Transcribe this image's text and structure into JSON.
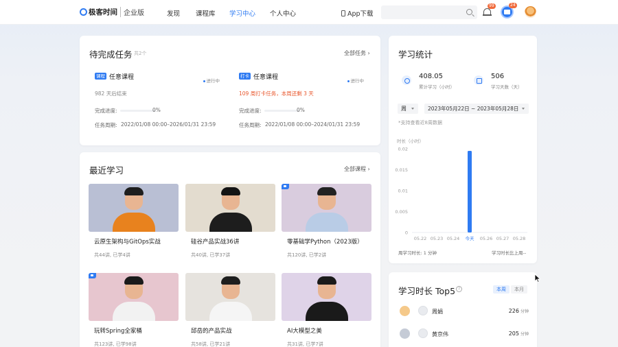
{
  "header": {
    "logo": "极客时间",
    "logo_edition": "企业版",
    "nav": [
      "发现",
      "课程库",
      "学习中心",
      "个人中心"
    ],
    "active_nav": "学习中心",
    "app_download": "App下载",
    "search_placeholder": "",
    "bell_badge": "99",
    "vip_badge": "24"
  },
  "tasks": {
    "title": "待完成任务",
    "count": "共2个",
    "all_label": "全部任务",
    "items": [
      {
        "tag": "课程",
        "name": "任意课程",
        "status": "进行中",
        "note": "982 天后结束",
        "progress_label": "完成进度:",
        "progress": "0%",
        "period_label": "任务周期:",
        "period": "2022/01/08 00:00–2026/01/31 23:59"
      },
      {
        "tag": "打卡",
        "name": "任意课程",
        "status": "进行中",
        "note": "109 周打卡任务，本周还剩 3 天",
        "progress_label": "完成进度:",
        "progress": "0%",
        "period_label": "任务周期:",
        "period": "2022/01/08 00:00–2024/01/31 23:59"
      }
    ]
  },
  "recent": {
    "title": "最近学习",
    "all_label": "全部课程",
    "courses": [
      {
        "title": "云原生架构与GitOps实战",
        "meta": "共44讲, 已学4讲",
        "bg": "#b9bfd4",
        "shirt": "#e8821e",
        "hair": "#1e1e1e",
        "video": false
      },
      {
        "title": "硅谷产品实战36讲",
        "meta": "共40讲, 已学37讲",
        "bg": "#e3dccf",
        "shirt": "#1d1d1d",
        "hair": "#141414",
        "video": false
      },
      {
        "title": "零基础学Python（2023版）",
        "meta": "共120讲, 已学2讲",
        "bg": "#d9ccde",
        "shirt": "#b9cce6",
        "hair": "#222222",
        "video": true
      },
      {
        "title": "玩转Spring全家桶",
        "meta": "共123讲, 已学98讲",
        "bg": "#e7c6cf",
        "shirt": "#f2f2f2",
        "hair": "#1a1a1a",
        "video": true
      },
      {
        "title": "邱岳的产品实战",
        "meta": "共58讲, 已学21讲",
        "bg": "#e6e3de",
        "shirt": "#f5f5f5",
        "hair": "#1e1e1e",
        "video": false
      },
      {
        "title": "AI大模型之美",
        "meta": "共31讲, 已学7讲",
        "bg": "#dfd3e8",
        "shirt": "#1a1a1a",
        "hair": "#1a1a1a",
        "video": false
      }
    ]
  },
  "stats": {
    "title": "学习统计",
    "total_hours": "408.05",
    "total_hours_label": "累计学习（小时）",
    "days": "506",
    "days_label": "学习天数（天）",
    "period_select": "周",
    "range_select": "2023年05月22日 ~ 2023年05月28日",
    "hint": "*支持查看近8周数据",
    "week_total_label": "周学习时长: 1 分钟",
    "compare_label": "学习时长比上周--"
  },
  "chart_data": {
    "type": "bar",
    "ylabel": "时长（小时）",
    "categories": [
      "05.22",
      "05.23",
      "05.24",
      "今天",
      "05.26",
      "05.27",
      "05.28"
    ],
    "values": [
      0,
      0,
      0,
      0.0195,
      0,
      0,
      0
    ],
    "ylim": [
      0,
      0.02
    ],
    "yticks": [
      "0.02",
      "0.015",
      "0.01",
      "0.005",
      "0"
    ],
    "highlight": "今天",
    "bar_color": "#2f7bf2"
  },
  "top5": {
    "title": "学习时长 Top5",
    "tabs": [
      "本周",
      "本月"
    ],
    "active_tab": "本周",
    "unit": "分钟",
    "users": [
      {
        "name": "周娟",
        "minutes": "226",
        "rank_color": "#f5c98a"
      },
      {
        "name": "黄京伟",
        "minutes": "205",
        "rank_color": "#c5cbd6"
      }
    ]
  },
  "colors": {
    "accent": "#2f7bf2",
    "badge": "#f06a3b",
    "warning": "#e8552a"
  }
}
